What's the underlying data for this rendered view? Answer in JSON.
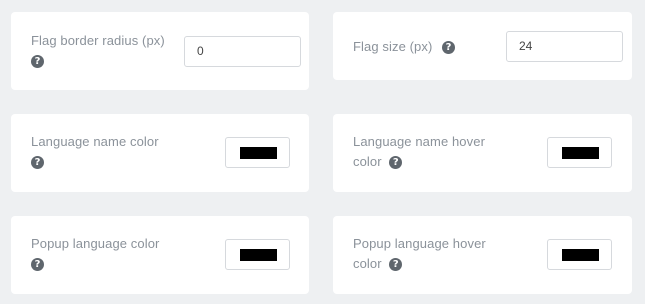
{
  "settings": {
    "flag_border_radius": {
      "label": "Flag border radius (px)",
      "value": "0",
      "help_icon": "question-circle-icon"
    },
    "flag_size": {
      "label": "Flag size (px)",
      "value": "24",
      "help_icon": "question-circle-icon"
    },
    "language_name_color": {
      "label": "Language name color",
      "color": "#000000",
      "help_icon": "question-circle-icon"
    },
    "language_name_hover_color": {
      "label_line1": "Language name hover",
      "label_line2": "color",
      "color": "#000000",
      "help_icon": "question-circle-icon"
    },
    "popup_language_color": {
      "label": "Popup language color",
      "color": "#000000",
      "help_icon": "question-circle-icon"
    },
    "popup_language_hover_color": {
      "label_line1": "Popup language hover",
      "label_line2": "color",
      "color": "#000000",
      "help_icon": "question-circle-icon"
    }
  },
  "help_glyph": "?"
}
